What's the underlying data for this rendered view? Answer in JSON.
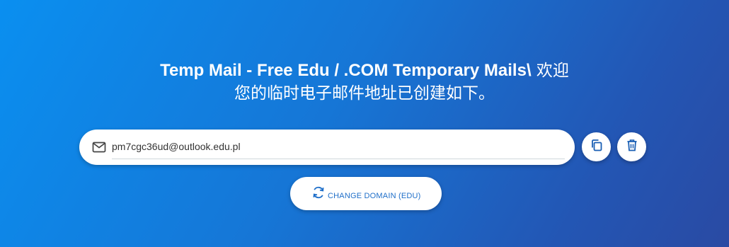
{
  "heading": {
    "title_bold": "Temp Mail - Free Edu / .COM Temporary Mails\\",
    "title_rest_line1": " 欢迎",
    "title_line2": "您的临时电子邮件地址已创建如下。"
  },
  "email": {
    "icon": "envelope-icon",
    "address": "pm7cgc36ud@outlook.edu.pl"
  },
  "actions": {
    "copy_icon": "copy-icon",
    "delete_icon": "trash-icon",
    "change_domain_icon": "refresh-icon",
    "change_domain_label": "CHANGE DOMAIN (EDU)"
  },
  "colors": {
    "gradient_start": "#0a8ff0",
    "gradient_end": "#2a4aa3",
    "accent": "#1f6fc9",
    "icon": "#1a5fb4"
  }
}
